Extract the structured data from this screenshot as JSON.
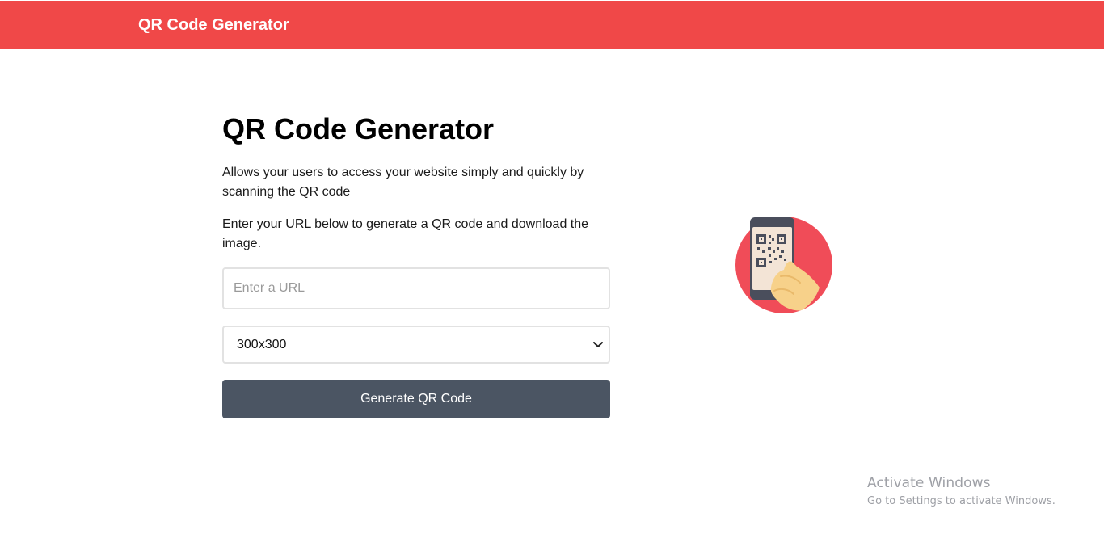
{
  "header": {
    "brand": "QR Code Generator",
    "background_color": "#f04848"
  },
  "main": {
    "title": "QR Code Generator",
    "description": "Allows your users to access your website simply and quickly by scanning the QR code",
    "instruction": "Enter your URL below to generate a QR code and download the image.",
    "url_input": {
      "value": "",
      "placeholder": "Enter a URL"
    },
    "size_select": {
      "selected": "300x300",
      "icon": "chevron-down-icon"
    },
    "generate_button": {
      "label": "Generate QR Code",
      "color": "#4b5563"
    }
  },
  "illustration": {
    "icon": "qr-scan-phone-icon",
    "circle_color": "#f04c58"
  },
  "os_watermark": {
    "title": "Activate Windows",
    "subtitle": "Go to Settings to activate Windows."
  }
}
